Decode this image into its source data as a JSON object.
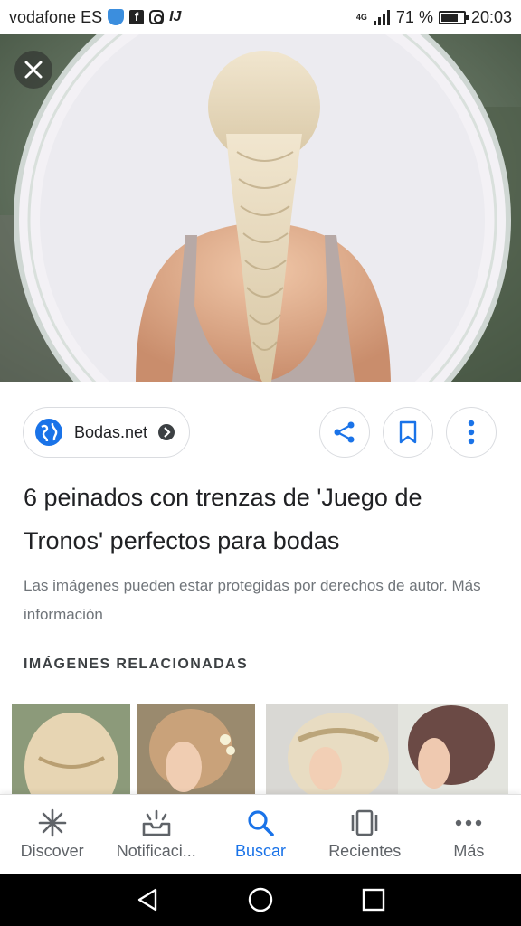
{
  "status_bar": {
    "carrier": "vodafone ES",
    "network": "4G",
    "battery_percent": "71 %",
    "battery_level": 0.71,
    "time": "20:03",
    "icons": [
      "shield-icon",
      "facebook-icon",
      "instagram-icon",
      "ij-icon",
      "signal-icon",
      "battery-icon"
    ]
  },
  "hero": {
    "close_icon": "close-icon"
  },
  "source": {
    "site_name": "Bodas.net",
    "icons": [
      "globe-icon",
      "arrow-forward-icon"
    ]
  },
  "actions": {
    "share_icon": "share-icon",
    "bookmark_icon": "bookmark-icon",
    "more_icon": "more-vert-icon"
  },
  "article": {
    "title": "6 peinados con trenzas de 'Juego de Tronos' perfectos para bodas",
    "copyright_notice": "Las imágenes pueden estar protegidas por derechos de autor. Más información"
  },
  "related": {
    "heading": "IMÁGENES RELACIONADAS"
  },
  "bottom_nav": {
    "items": [
      {
        "label": "Discover",
        "icon": "asterisk-icon",
        "active": false
      },
      {
        "label": "Notificaci...",
        "icon": "inbox-icon",
        "active": false
      },
      {
        "label": "Buscar",
        "icon": "search-icon",
        "active": true
      },
      {
        "label": "Recientes",
        "icon": "recents-icon",
        "active": false
      },
      {
        "label": "Más",
        "icon": "more-horiz-icon",
        "active": false
      }
    ]
  },
  "colors": {
    "accent": "#1a73e8",
    "text_primary": "#202124",
    "text_secondary": "#70757a",
    "hero_background": "#5b6b58"
  }
}
